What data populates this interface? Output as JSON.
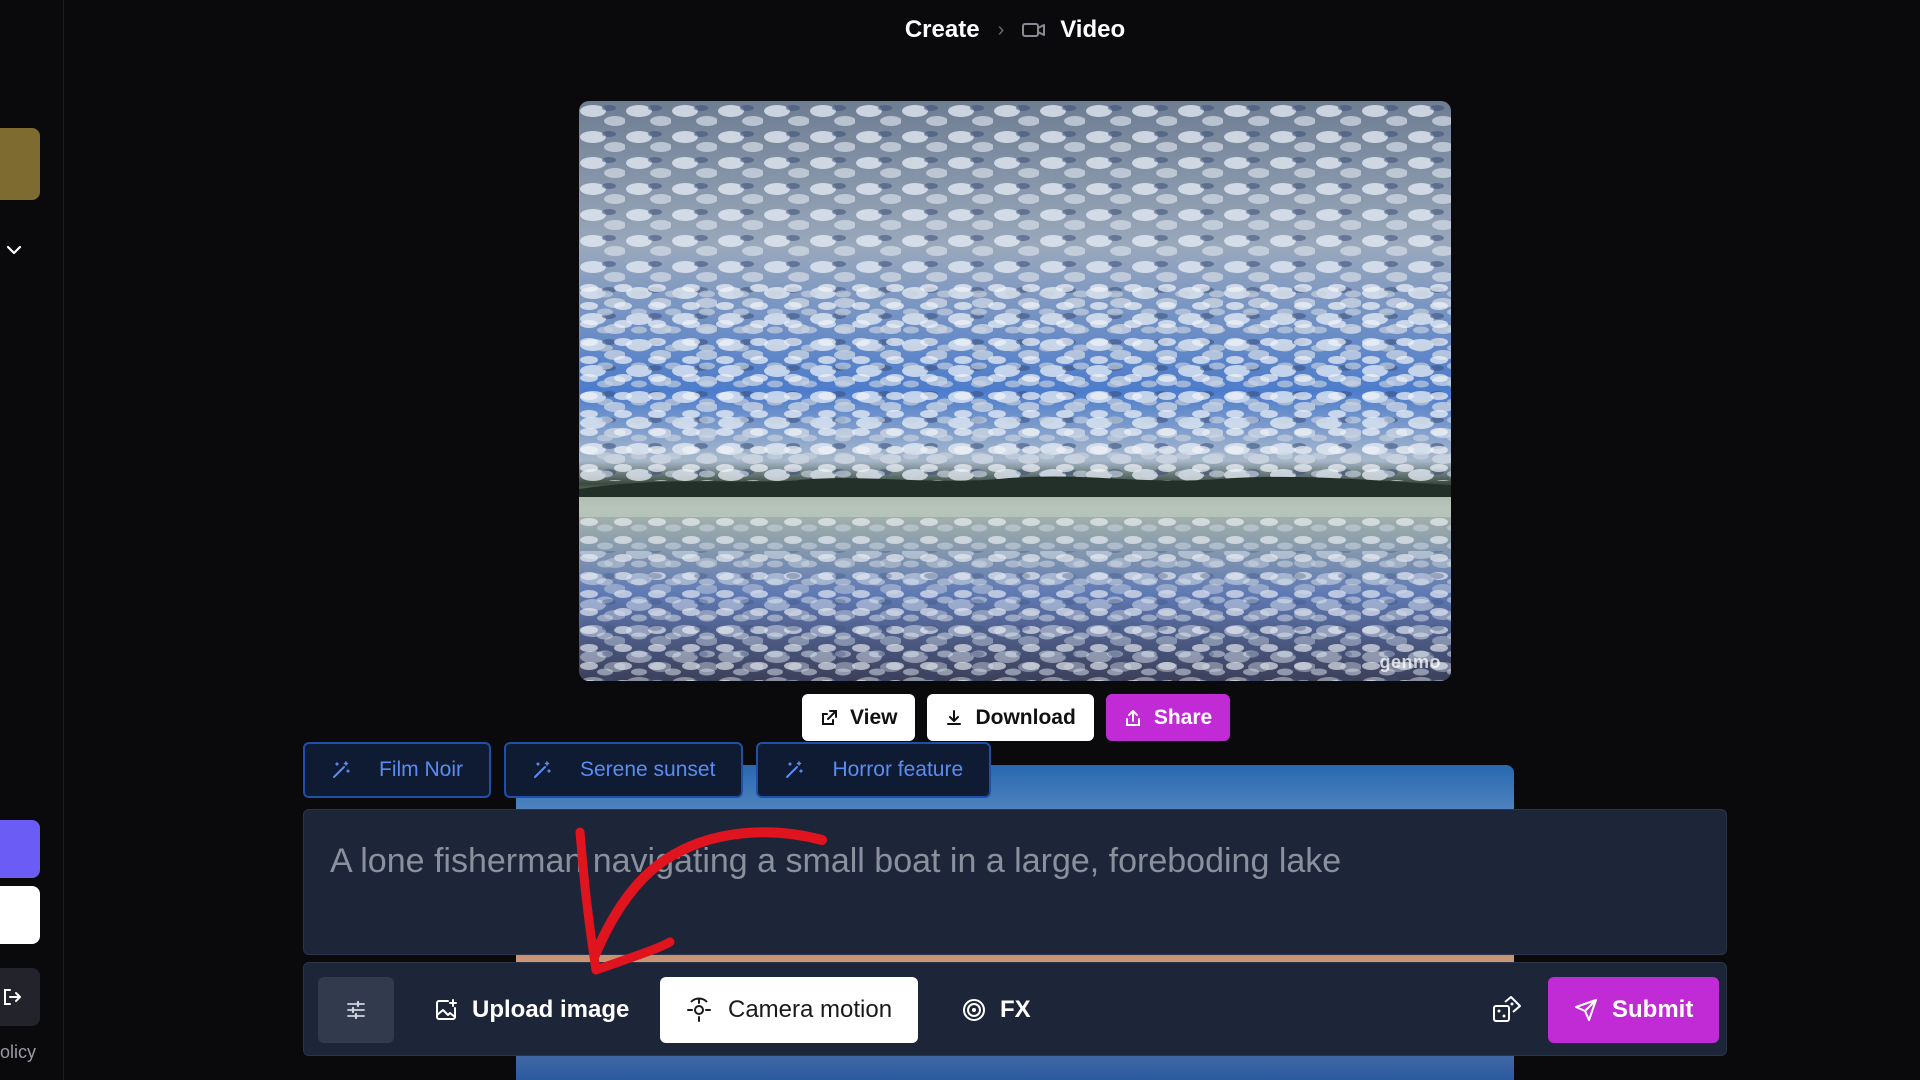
{
  "breadcrumb": {
    "create": "Create",
    "separator": "›",
    "video": "Video",
    "video_icon": "video-camera-icon"
  },
  "sidebar": {
    "policy_text": "olicy",
    "colors": {
      "gold": "#7d6b30",
      "purple": "#6b5cf6"
    }
  },
  "preview": {
    "watermark": "genmo",
    "actions": {
      "view_label": "View",
      "download_label": "Download",
      "share_label": "Share"
    }
  },
  "style_chips": [
    {
      "label": "Film Noir",
      "icon": "magic-wand-icon"
    },
    {
      "label": "Serene sunset",
      "icon": "magic-wand-icon"
    },
    {
      "label": "Horror feature",
      "icon": "magic-wand-icon"
    }
  ],
  "prompt": {
    "value": "A lone fisherman navigating a small boat in a large, foreboding lake"
  },
  "toolbar": {
    "upload_label": "Upload image",
    "camera_label": "Camera motion",
    "fx_label": "FX",
    "submit_label": "Submit"
  },
  "colors": {
    "accent": "#c02bd6",
    "chip_text": "#5b8cf2",
    "chip_border": "#1f4fa8",
    "panel": "#1d2638",
    "annotation": "#e0141e"
  }
}
